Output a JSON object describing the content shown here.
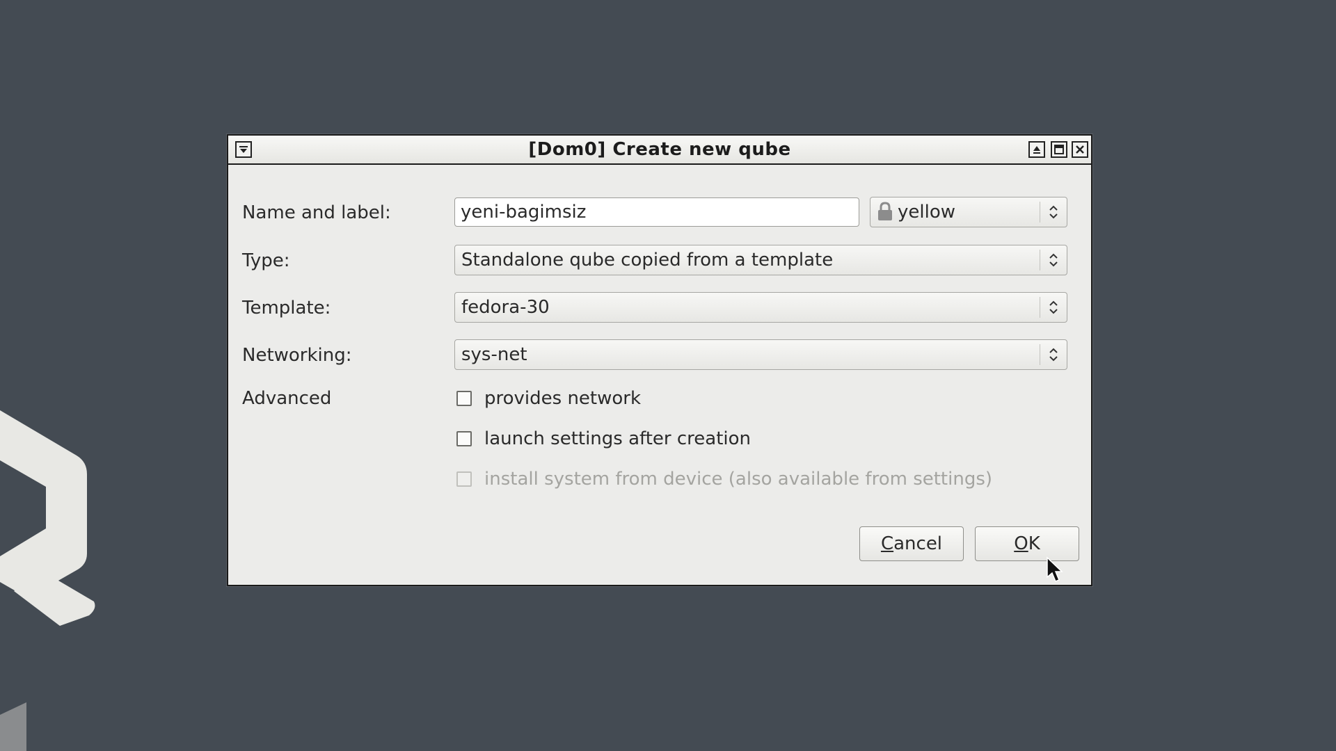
{
  "window": {
    "title": "[Dom0] Create new qube"
  },
  "form": {
    "name_label": "Name and label:",
    "name_value": "yeni-bagimsiz",
    "label_color_value": "yellow",
    "label_color_hex": "#e5c100",
    "type_label": "Type:",
    "type_value": "Standalone qube copied from a template",
    "template_label": "Template:",
    "template_value": "fedora-30",
    "networking_label": "Networking:",
    "networking_value": "sys-net",
    "advanced_label": "Advanced",
    "options": [
      {
        "label": "provides network",
        "checked": false,
        "enabled": true
      },
      {
        "label": "launch settings after creation",
        "checked": false,
        "enabled": true
      },
      {
        "label": "install system from device (also available from settings)",
        "checked": false,
        "enabled": false
      }
    ]
  },
  "buttons": {
    "cancel_mnemonic": "C",
    "cancel_rest": "ancel",
    "ok_mnemonic": "O",
    "ok_rest": "K"
  },
  "icons": {
    "window_menu": "window-menu-icon",
    "shade": "shade-icon",
    "maximize": "maximize-icon",
    "close": "close-icon",
    "lock": "lock-icon",
    "combo_arrows": "updown-arrows-icon",
    "logo": "qubes-logo",
    "cursor": "mouse-pointer-icon"
  }
}
